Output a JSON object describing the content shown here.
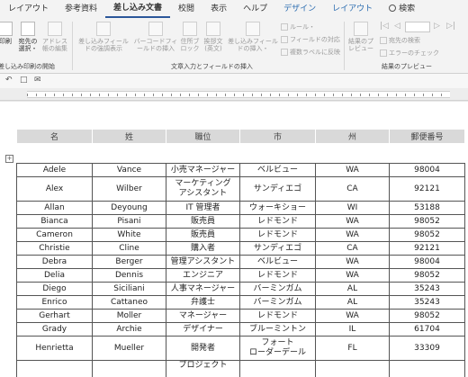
{
  "ribbon_tabs": [
    {
      "label": "レイアウト",
      "style": ""
    },
    {
      "label": "参考資料",
      "style": ""
    },
    {
      "label": "差し込み文書",
      "style": "active"
    },
    {
      "label": "校閲",
      "style": ""
    },
    {
      "label": "表示",
      "style": ""
    },
    {
      "label": "ヘルプ",
      "style": ""
    },
    {
      "label": "デザイン",
      "style": "blue"
    },
    {
      "label": "レイアウト",
      "style": "blue"
    },
    {
      "label": "検索",
      "style": "search"
    }
  ],
  "ribbon": {
    "btn_insert_print": "印刷",
    "btn_insert_print2": "込み",
    "btn_recipients": "宛先の選択・",
    "btn_address_edit": "アドレス帳の編集",
    "group_start": "差し込み印刷の開始",
    "btn_highlight": "差し込みフィールドの強調表示",
    "btn_barcode": "バーコードフィールドの挿入",
    "btn_address": "住所ブロック",
    "btn_greeting": "挨拶文(英文)",
    "btn_insert_field": "差し込みフィールドの挿入・",
    "small_rules": "ルール・",
    "small_match": "フィールドの対応",
    "small_multi": "複数ラベルに反映",
    "group_fields": "文章入力とフィールドの挿入",
    "btn_preview": "結果のプレビュー",
    "small_find": "宛先の検索",
    "small_check": "エラーのチェック",
    "group_preview": "結果のプレビュー"
  },
  "icons": {
    "qat_undo": "↶",
    "qat_save": "□",
    "qat_comment": "✉",
    "add_row": "+"
  },
  "table": {
    "headers": [
      "名",
      "姓",
      "職位",
      "市",
      "州",
      "郵便番号"
    ],
    "rows": [
      [
        "Adele",
        "Vance",
        "小売マネージャー",
        "ベルビュー",
        "WA",
        "98004"
      ],
      [
        "Alex",
        "Wilber",
        "マーケティング\nアシスタント",
        "サンディエゴ",
        "CA",
        "92121"
      ],
      [
        "Allan",
        "Deyoung",
        "IT 管理者",
        "ウォーキショー",
        "WI",
        "53188"
      ],
      [
        "Bianca",
        "Pisani",
        "販売員",
        "レドモンド",
        "WA",
        "98052"
      ],
      [
        "Cameron",
        "White",
        "販売員",
        "レドモンド",
        "WA",
        "98052"
      ],
      [
        "Christie",
        "Cline",
        "購入者",
        "サンディエゴ",
        "CA",
        "92121"
      ],
      [
        "Debra",
        "Berger",
        "管理アシスタント",
        "ベルビュー",
        "WA",
        "98004"
      ],
      [
        "Delia",
        "Dennis",
        "エンジニア",
        "レドモンド",
        "WA",
        "98052"
      ],
      [
        "Diego",
        "Siciliani",
        "人事マネージャー",
        "バーミンガム",
        "AL",
        "35243"
      ],
      [
        "Enrico",
        "Cattaneo",
        "弁護士",
        "バーミンガム",
        "AL",
        "35243"
      ],
      [
        "Gerhart",
        "Moller",
        "マネージャー",
        "レドモンド",
        "WA",
        "98052"
      ],
      [
        "Grady",
        "Archie",
        "デザイナー",
        "ブルーミントン",
        "IL",
        "61704"
      ],
      [
        "Henrietta",
        "Mueller",
        "開発者",
        "フォート\nローダーデール",
        "FL",
        "33309"
      ],
      [
        "",
        "",
        "プロジェクト",
        "",
        "",
        ""
      ]
    ]
  }
}
